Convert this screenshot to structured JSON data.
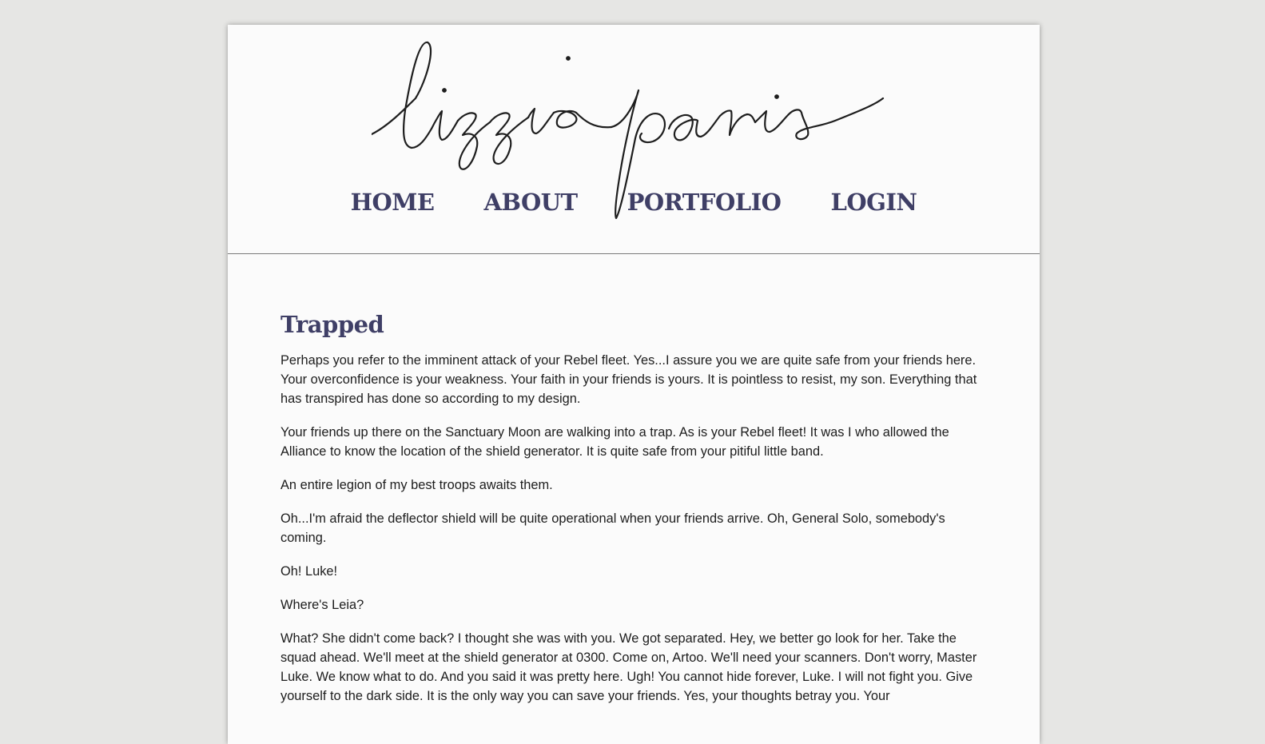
{
  "site": {
    "logo_text": "lizzieparis"
  },
  "nav": {
    "items": [
      {
        "label": "HOME"
      },
      {
        "label": "ABOUT"
      },
      {
        "label": "PORTFOLIO"
      },
      {
        "label": "LOGIN"
      }
    ]
  },
  "post": {
    "title": "Trapped",
    "paragraphs": [
      "Perhaps you refer to the imminent attack of your Rebel fleet. Yes...I assure you we are quite safe from your friends here. Your overconfidence is your weakness. Your faith in your friends is yours. It is pointless to resist, my son. Everything that has transpired has done so according to my design.",
      "Your friends up there on the Sanctuary Moon are walking into a trap. As is your Rebel fleet! It was I who allowed the Alliance to know the location of the shield generator. It is quite safe from your pitiful little band.",
      "An entire legion of my best troops awaits them.",
      "Oh...I'm afraid the deflector shield will be quite operational when your friends arrive. Oh, General Solo, somebody's coming.",
      "Oh! Luke!",
      "Where's Leia?",
      "What? She didn't come back? I thought she was with you. We got separated. Hey, we better go look for her. Take the squad ahead. We'll meet at the shield generator at 0300. Come on, Artoo. We'll need your scanners. Don't worry, Master Luke. We know what to do. And you said it was pretty here. Ugh! You cannot hide forever, Luke. I will not fight you. Give yourself to the dark side. It is the only way you can save your friends. Yes, your thoughts betray you. Your"
    ]
  },
  "colors": {
    "background": "#e6e6e4",
    "page": "#fbfbfb",
    "accent": "#3f3f66",
    "text": "#1d1d1d"
  }
}
